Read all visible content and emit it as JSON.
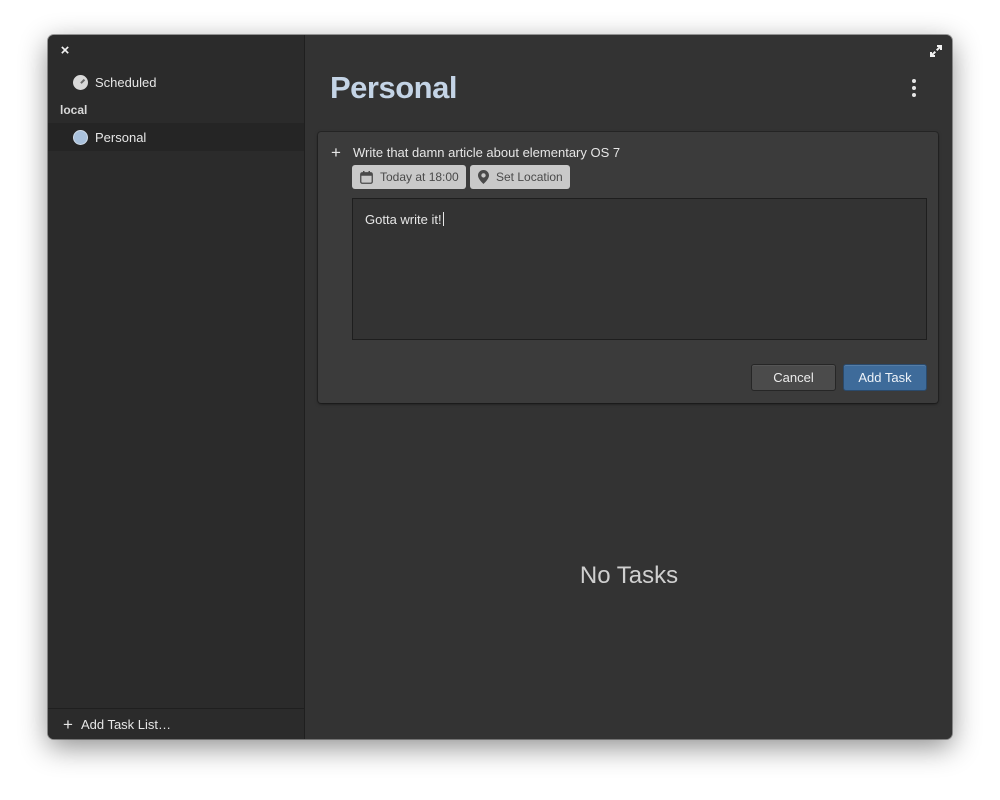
{
  "sidebar": {
    "close_label": "×",
    "items": [
      {
        "label": "Scheduled",
        "icon": "clock-icon"
      },
      {
        "label": "Personal",
        "icon": "circle-icon"
      }
    ],
    "section_heading": "local",
    "add_list_label": "Add Task List…"
  },
  "main": {
    "title": "Personal",
    "new_task": {
      "title": "Write that damn article about elementary OS 7",
      "due_label": "Today at 18:00",
      "location_label": "Set Location",
      "notes": "Gotta write it!",
      "cancel_label": "Cancel",
      "add_label": "Add Task"
    },
    "empty_label": "No Tasks"
  },
  "colors": {
    "accent": "#3e6b9a",
    "title": "#c4d4e6",
    "window_bg": "#333333",
    "sidebar_bg": "#2b2b2b"
  }
}
